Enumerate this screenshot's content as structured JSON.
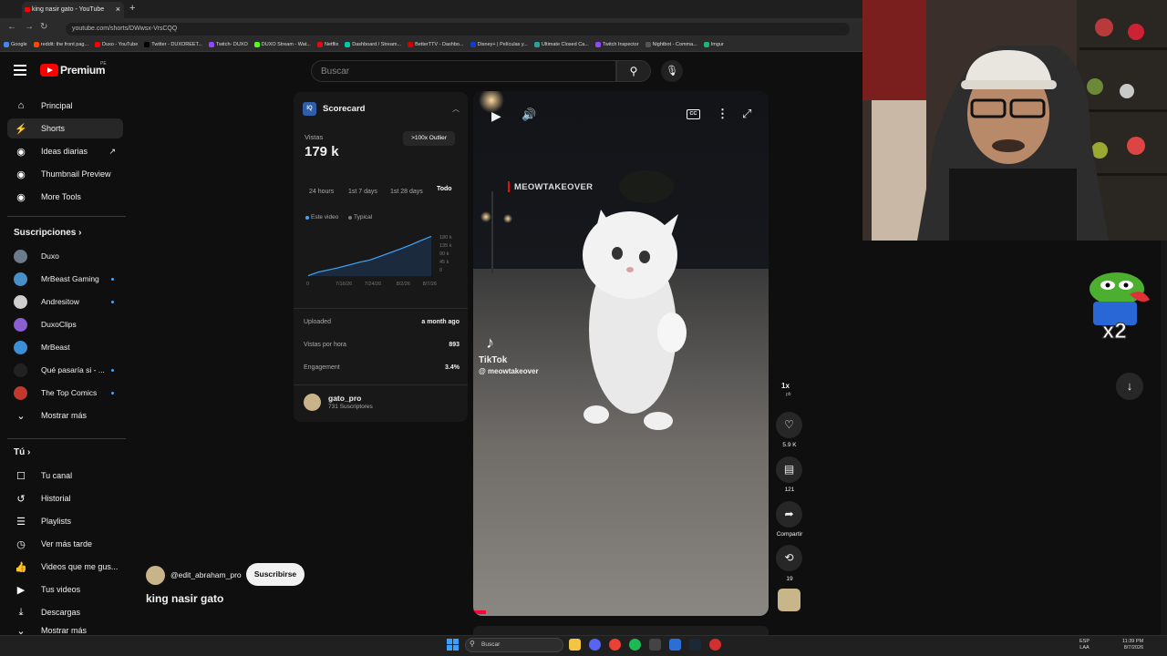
{
  "browser": {
    "tab_title": "king nasir gato - YouTube",
    "url": "youtube.com/shorts/DWwsx-VrsCQQ",
    "bookmarks": [
      {
        "label": "Google",
        "color": "#4285f4"
      },
      {
        "label": "reddit: the front pag...",
        "color": "#ff4500"
      },
      {
        "label": "Duxo - YouTube",
        "color": "#ff0000"
      },
      {
        "label": "Twitter - DUXOREET...",
        "color": "#000000"
      },
      {
        "label": "Twitch- DUXO",
        "color": "#9146ff"
      },
      {
        "label": "DUXO Stream - Wat...",
        "color": "#53fc18"
      },
      {
        "label": "Netflix",
        "color": "#e50914"
      },
      {
        "label": "Dashboard / Stream...",
        "color": "#00c9a7"
      },
      {
        "label": "BetterTTV - Dashbo...",
        "color": "#d50000"
      },
      {
        "label": "Disney+ | Películas y...",
        "color": "#113ccf"
      },
      {
        "label": "Ultimate Closed Ca...",
        "color": "#2aa198"
      },
      {
        "label": "Twitch Inspector",
        "color": "#9146ff"
      },
      {
        "label": "Nightbot - Comma...",
        "color": "#555555"
      },
      {
        "label": "Imgur",
        "color": "#1bb76e"
      }
    ]
  },
  "header": {
    "logo_text": "Premium",
    "region": "PE",
    "search_placeholder": "Buscar"
  },
  "sidebar": {
    "main": [
      {
        "label": "Principal",
        "icon": "home-icon",
        "glyph": "⌂"
      },
      {
        "label": "Shorts",
        "icon": "shorts-icon",
        "glyph": "⚡"
      },
      {
        "label": "Ideas diarias",
        "icon": "ideas-icon",
        "glyph": "◉"
      },
      {
        "label": "Thumbnail Preview",
        "icon": "thumbnail-icon",
        "glyph": "◉"
      },
      {
        "label": "More Tools",
        "icon": "tools-icon",
        "glyph": "◉"
      }
    ],
    "subs_heading": "Suscripciones",
    "subs": [
      {
        "label": "Duxo",
        "color": "#6b7b8c",
        "dot": false
      },
      {
        "label": "MrBeast Gaming",
        "color": "#4a90c8",
        "dot": true
      },
      {
        "label": "Andresitow",
        "color": "#cfcfcf",
        "dot": true
      },
      {
        "label": "DuxoClips",
        "color": "#8a5fd1",
        "dot": false
      },
      {
        "label": "MrBeast",
        "color": "#3a8fd6",
        "dot": false
      },
      {
        "label": "Qué pasaría si - ...",
        "color": "#222222",
        "dot": true
      },
      {
        "label": "The Top Comics",
        "color": "#c0392b",
        "dot": true
      }
    ],
    "show_more": "Mostrar más",
    "you_heading": "Tú",
    "you": [
      {
        "label": "Tu canal",
        "icon": "channel-icon",
        "glyph": "☐"
      },
      {
        "label": "Historial",
        "icon": "history-icon",
        "glyph": "↺"
      },
      {
        "label": "Playlists",
        "icon": "playlists-icon",
        "glyph": "☰"
      },
      {
        "label": "Ver más tarde",
        "icon": "clock-icon",
        "glyph": "◷"
      },
      {
        "label": "Videos que me gus...",
        "icon": "like-icon",
        "glyph": "👍"
      },
      {
        "label": "Tus videos",
        "icon": "videos-icon",
        "glyph": "▶"
      },
      {
        "label": "Descargas",
        "icon": "download-icon",
        "glyph": "⤓"
      },
      {
        "label": "Mostrar más",
        "icon": "more-icon",
        "glyph": "⌄"
      }
    ]
  },
  "scorecard": {
    "logo": "IQ",
    "title": "Scorecard",
    "views_label": "Vistas",
    "views": "179 k",
    "outlier": ">100x Outlier",
    "ranges": [
      "24 hours",
      "1st 7 days",
      "1st 28 days",
      "Todo"
    ],
    "legend": [
      {
        "label": "Este video",
        "color": "#3ea6ff"
      },
      {
        "label": "Typical",
        "color": "#777777"
      }
    ],
    "stats": [
      {
        "label": "Uploaded",
        "value": "a month ago"
      },
      {
        "label": "Vistas por hora",
        "value": "893"
      },
      {
        "label": "Engagement",
        "value": "3.4%"
      }
    ],
    "channel_name": "gato_pro",
    "channel_subs": "731 Suscriptores"
  },
  "chart_data": {
    "type": "area",
    "title": "",
    "x": [
      "0",
      "7/16/26",
      "7/24/26",
      "8/2/26",
      "8/7/26"
    ],
    "yticks": [
      "180 k",
      "135 k",
      "90 k",
      "45 k",
      "0"
    ],
    "ylim": [
      0,
      180
    ],
    "series": [
      {
        "name": "Este video",
        "x": [
          0,
          1,
          2,
          3,
          4,
          5,
          6,
          7,
          8,
          9,
          10,
          11,
          12
        ],
        "values": [
          2,
          18,
          28,
          38,
          50,
          62,
          72,
          88,
          105,
          122,
          140,
          160,
          178
        ]
      }
    ],
    "grid": false,
    "legend": "top-left"
  },
  "video": {
    "watermark": "MEOWTAKEOVER",
    "tiktok": "TikTok",
    "tiktok_handle": "@ meowtakeover",
    "cc": "CC"
  },
  "actions": {
    "speed": "1x",
    "speed_sub": "pb",
    "likes": "5.9 K",
    "comments": "121",
    "share": "Compartir",
    "remix": "19"
  },
  "overlay": {
    "handle": "@edit_abraham_pro",
    "subscribe": "Suscribirse",
    "title": "king nasir gato"
  },
  "taskbar": {
    "search": "Buscar",
    "lang": "ESP\nLAA",
    "time": "11:39 PM",
    "date": "8/7/2026"
  }
}
